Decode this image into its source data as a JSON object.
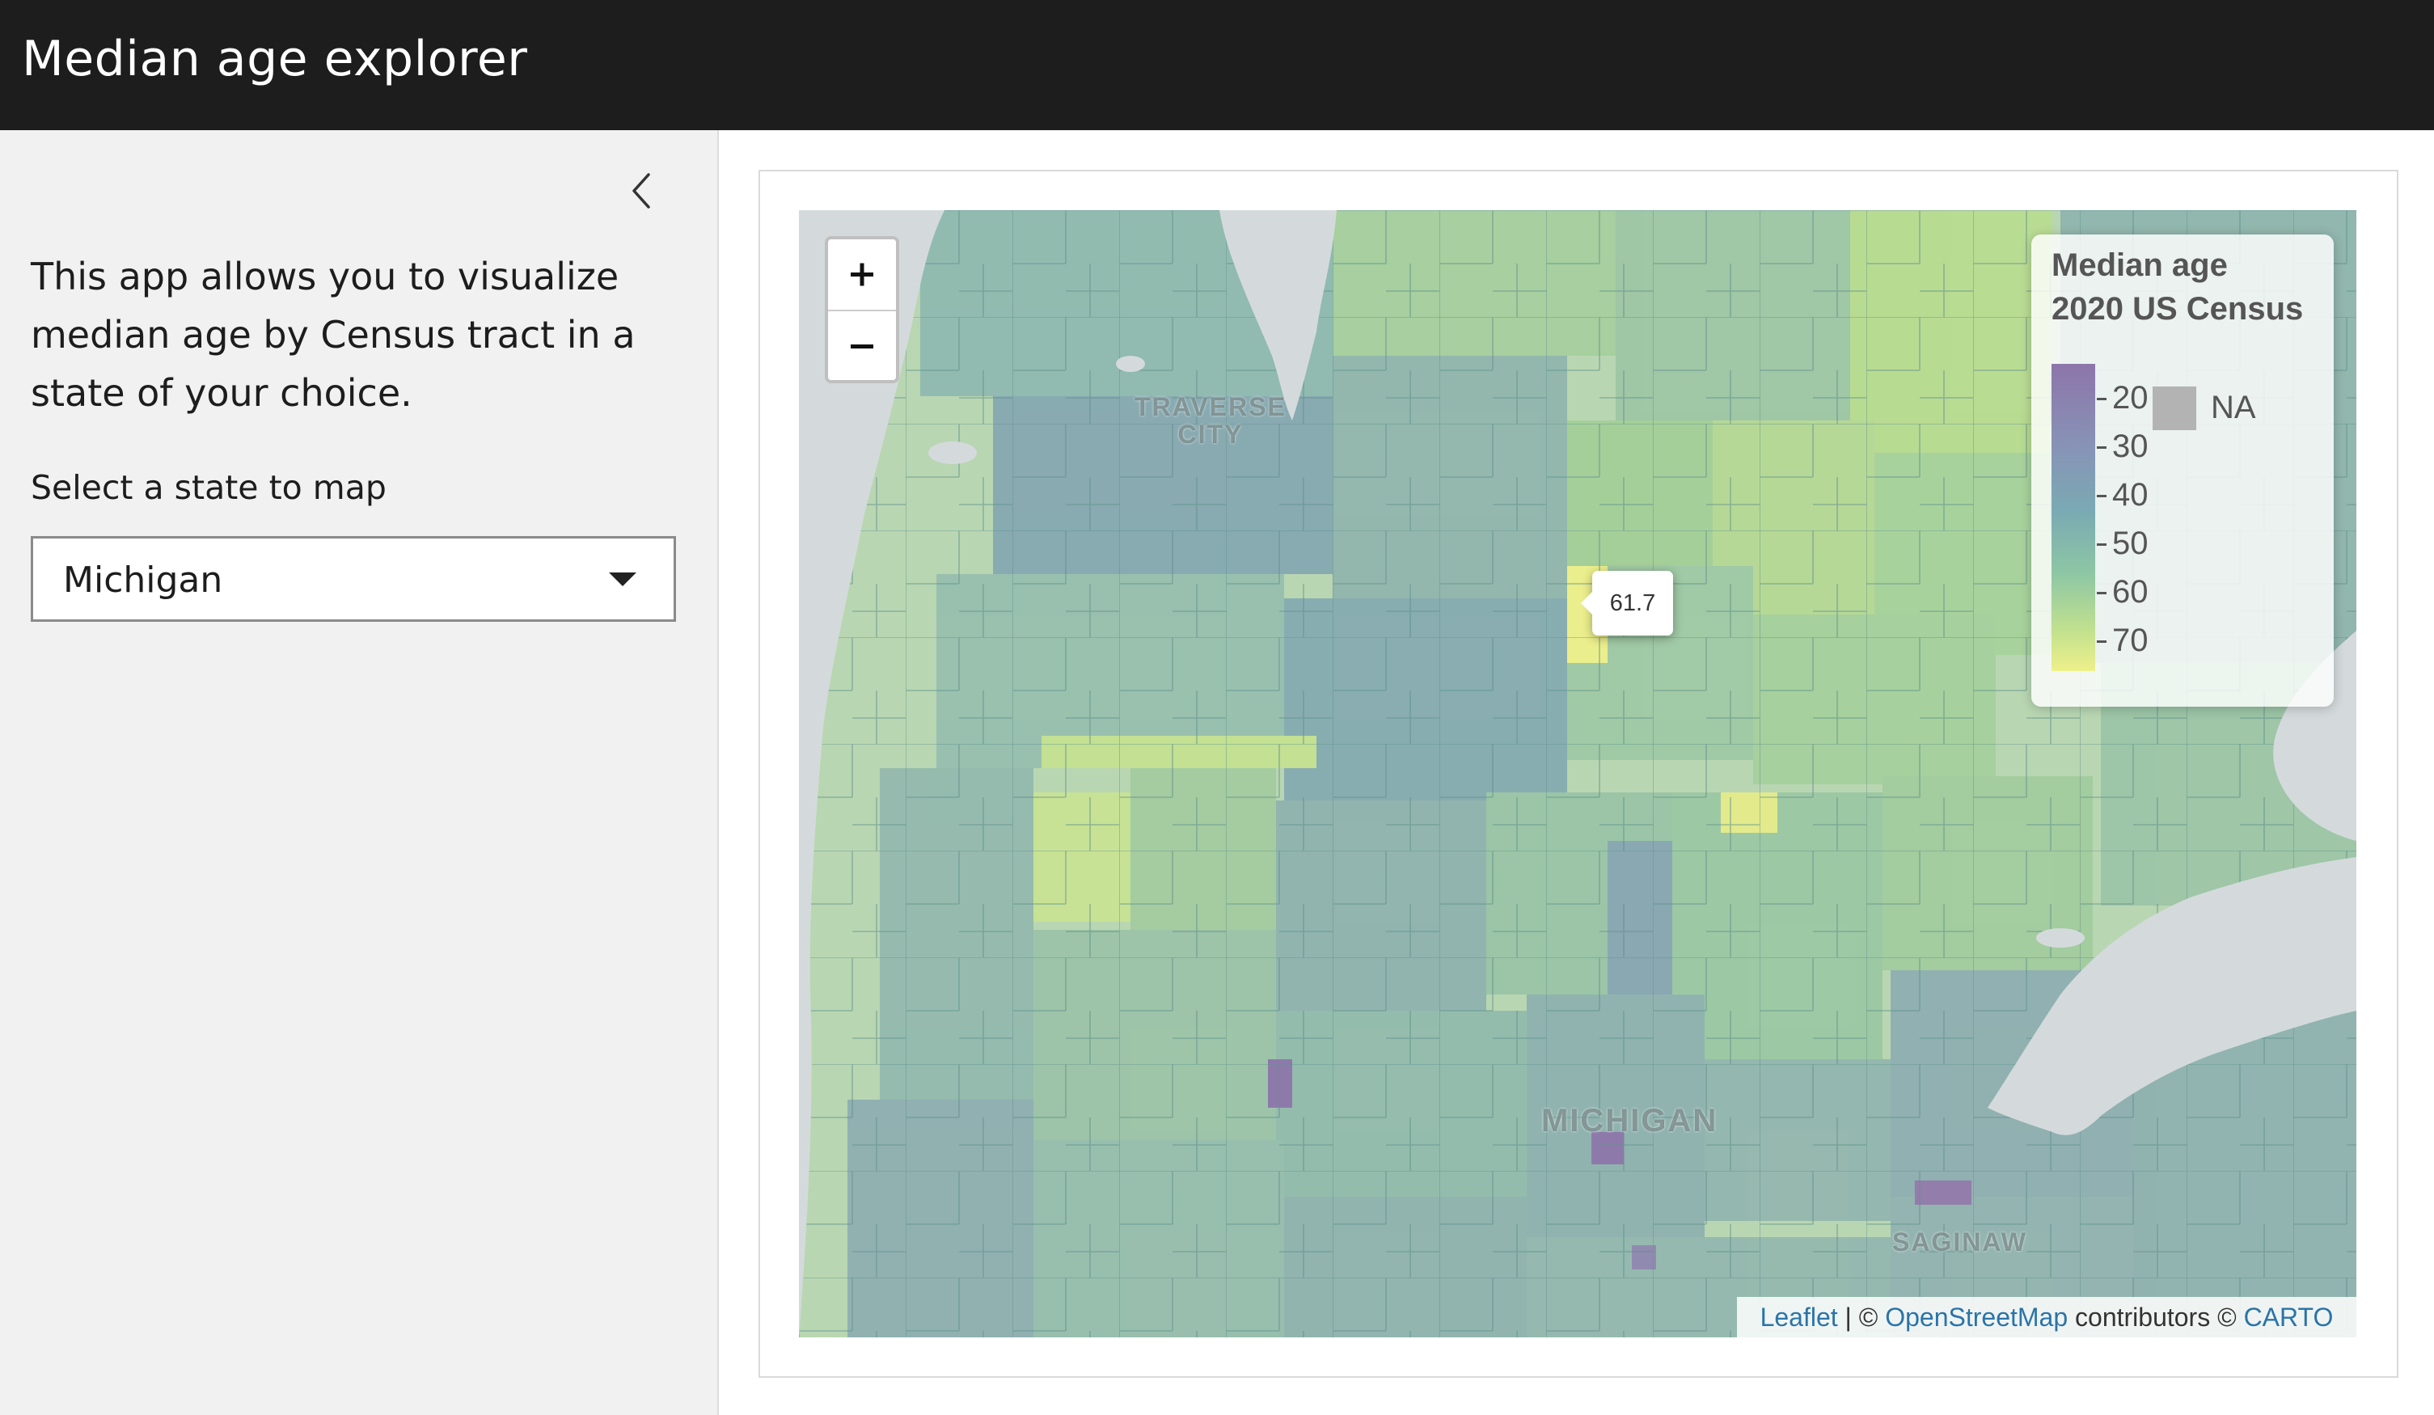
{
  "header": {
    "title": "Median age explorer"
  },
  "sidebar": {
    "collapse_icon": "chevron-left-icon",
    "intro": "This app allows you to visualize median age by Census tract in a state of your choice.",
    "select_label": "Select a state to map",
    "selected_state": "Michigan",
    "dropdown_icon": "caret-down-icon"
  },
  "map": {
    "zoom_in_label": "+",
    "zoom_out_label": "−",
    "tooltip_value": "61.7",
    "place_labels": [
      "TRAVERSE",
      "CITY",
      "MICHIGAN",
      "SAGINAW"
    ],
    "legend": {
      "title_line1": "Median age",
      "title_line2": "2020 US Census",
      "ticks": [
        "20",
        "30",
        "40",
        "50",
        "60",
        "70"
      ],
      "na_label": "NA",
      "colors": [
        "#8d75aa",
        "#8794b7",
        "#7aaab3",
        "#8dc6a5",
        "#bfe08f",
        "#eef08a"
      ],
      "na_color": "#b3b3b3"
    },
    "attribution": {
      "leaflet": "Leaflet",
      "sep": " | © ",
      "osm": "OpenStreetMap",
      "contrib": " contributors © ",
      "carto": "CARTO"
    }
  }
}
